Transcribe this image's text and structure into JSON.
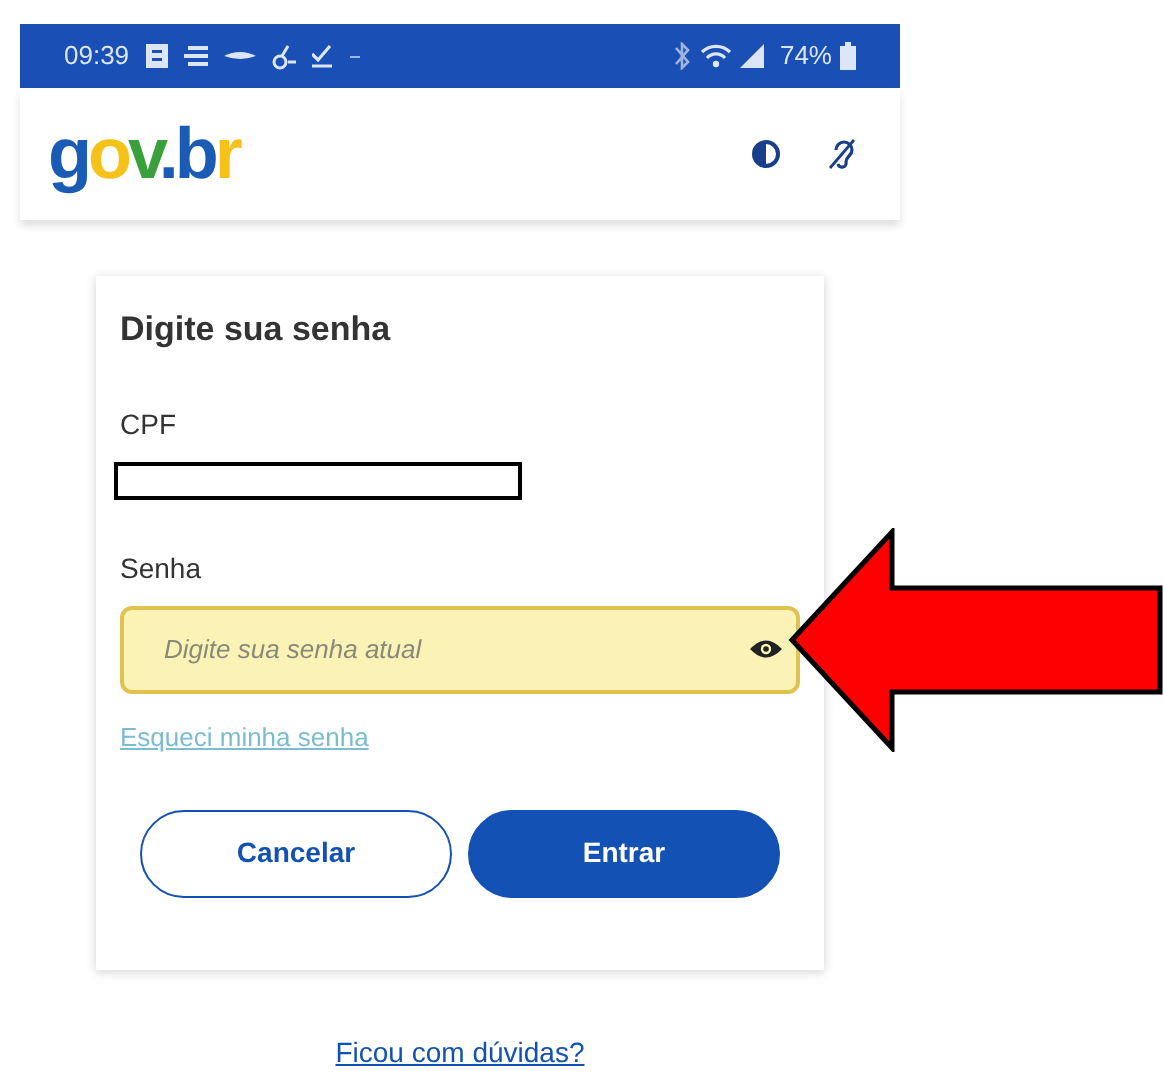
{
  "status_bar": {
    "time": "09:39",
    "battery": "74%"
  },
  "header": {
    "logo": "gov.br"
  },
  "form": {
    "title": "Digite sua senha",
    "cpf_label": "CPF",
    "password_label": "Senha",
    "password": {
      "placeholder": "Digite sua senha atual"
    },
    "forgot_link": "Esqueci minha senha",
    "buttons": [
      {
        "label": "Cancelar",
        "kind": "outline"
      },
      {
        "label": "Entrar",
        "kind": "primary"
      }
    ]
  },
  "help_link": "Ficou com dúvidas?"
}
